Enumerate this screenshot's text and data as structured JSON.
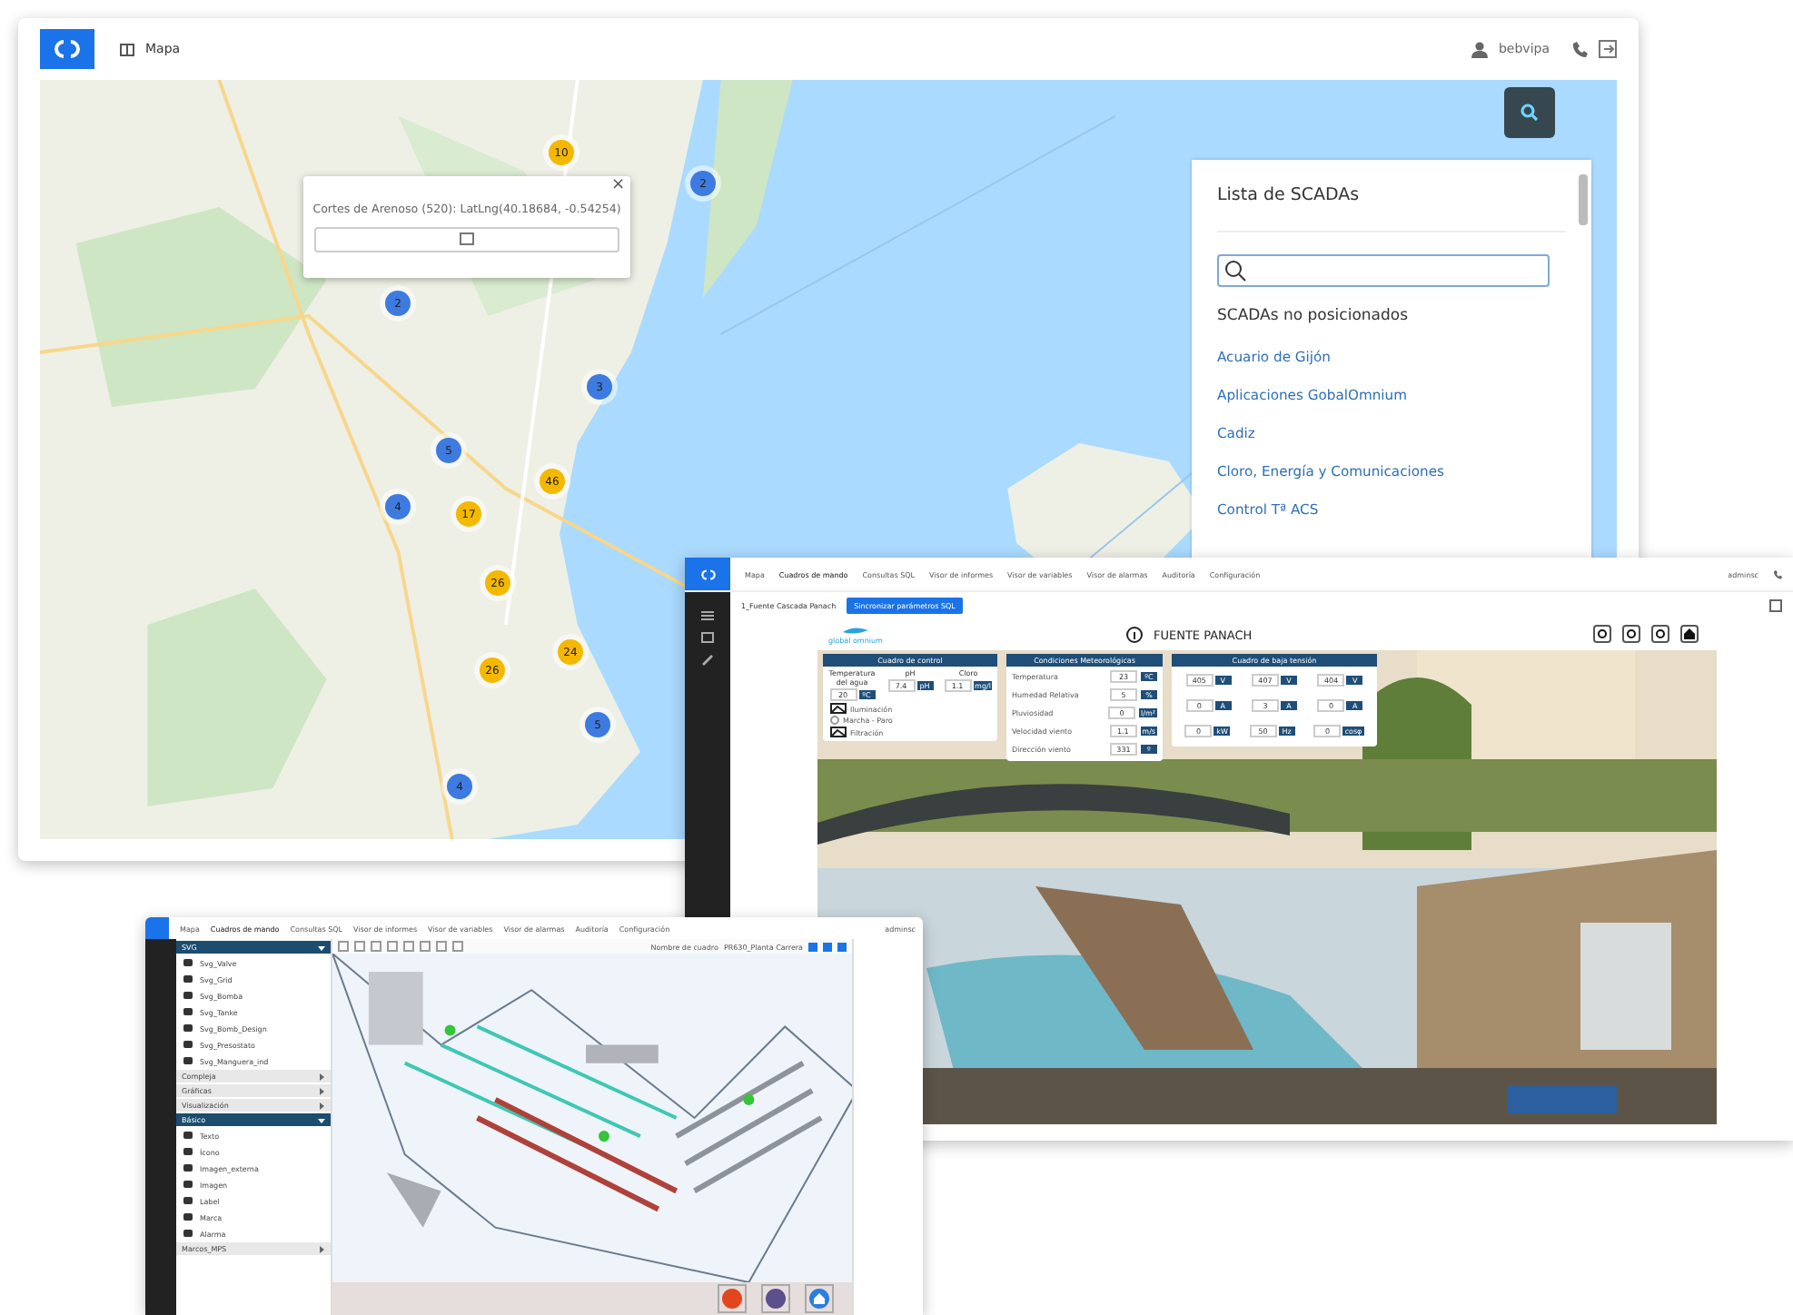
{
  "map_window": {
    "nav": [
      {
        "label": "Mapa",
        "selected": true
      }
    ],
    "user": "bebvipa",
    "popup": {
      "text": "Cortes de Arenoso (520): LatLng(40.18684, -0.54254)",
      "close": "×"
    },
    "markers": [
      {
        "count": "10",
        "color": "#f5b800"
      },
      {
        "count": "2",
        "color": "#3d7be0"
      },
      {
        "count": "2",
        "color": "#3d7be0"
      },
      {
        "count": "3",
        "color": "#3d7be0"
      },
      {
        "count": "5",
        "color": "#3d7be0"
      },
      {
        "count": "46",
        "color": "#f5b800"
      },
      {
        "count": "4",
        "color": "#3d7be0"
      },
      {
        "count": "17",
        "color": "#f5b800"
      },
      {
        "count": "26",
        "color": "#f5b800"
      },
      {
        "count": "26",
        "color": "#f5b800"
      },
      {
        "count": "24",
        "color": "#f5b800"
      },
      {
        "count": "5",
        "color": "#3d7be0"
      },
      {
        "count": "4",
        "color": "#3d7be0"
      }
    ],
    "scada_list": {
      "title": "Lista de SCADAs",
      "section": "SCADAs no posicionados",
      "items": [
        "Acuario de Gijón",
        "Aplicaciones GobalOmnium",
        "Cadiz",
        "Cloro, Energía y Comunicaciones",
        "Control Tª ACS"
      ]
    }
  },
  "scada_window": {
    "nav": [
      {
        "label": "Mapa",
        "selected": false
      },
      {
        "label": "Cuadros de mando",
        "selected": true
      },
      {
        "label": "Consultas SQL",
        "selected": false
      },
      {
        "label": "Visor de informes",
        "selected": false
      },
      {
        "label": "Visor de variables",
        "selected": false
      },
      {
        "label": "Visor de alarmas",
        "selected": false
      },
      {
        "label": "Auditoría",
        "selected": false
      },
      {
        "label": "Configuración",
        "selected": false
      }
    ],
    "user": "adminsc",
    "breadcrumb": "1_Fuente Cascada Panach",
    "action_button": "Sincronizar parámetros SQL",
    "brand": "global omnium",
    "title": "FUENTE PANACH",
    "control": {
      "title": "Cuadro de control",
      "measures": [
        {
          "label": "Temperatura del agua",
          "value": "20",
          "unit": "ºC"
        },
        {
          "label": "pH",
          "value": "7.4",
          "unit": "pH"
        },
        {
          "label": "Cloro",
          "value": "1.1",
          "unit": "mg/l"
        }
      ],
      "toggles": [
        {
          "label": "Iluminación",
          "kind": "switch"
        },
        {
          "label": "Marcha - Paro",
          "kind": "radio",
          "on": false
        },
        {
          "label": "Filtración",
          "kind": "switch"
        }
      ]
    },
    "weather": {
      "title": "Condiciones Meteorológicas",
      "rows": [
        {
          "label": "Temperatura",
          "value": "23",
          "unit": "ºC"
        },
        {
          "label": "Humedad Relativa",
          "value": "5",
          "unit": "%"
        },
        {
          "label": "Pluviosidad",
          "value": "0",
          "unit": "l/m²"
        },
        {
          "label": "Velocidad viento",
          "value": "1.1",
          "unit": "m/s"
        },
        {
          "label": "Dirección viento",
          "value": "331",
          "unit": "º"
        }
      ]
    },
    "low_voltage": {
      "title": "Cuadro de baja tensión",
      "rows": [
        [
          {
            "value": "405",
            "unit": "V"
          },
          {
            "value": "407",
            "unit": "V"
          },
          {
            "value": "404",
            "unit": "V"
          }
        ],
        [
          {
            "value": "0",
            "unit": "A"
          },
          {
            "value": "3",
            "unit": "A"
          },
          {
            "value": "0",
            "unit": "A"
          }
        ],
        [
          {
            "value": "0",
            "unit": "kW"
          },
          {
            "value": "50",
            "unit": "Hz"
          },
          {
            "value": "0",
            "unit": "cosφ"
          }
        ]
      ]
    }
  },
  "editor_window": {
    "nav": [
      {
        "label": "Mapa",
        "selected": false
      },
      {
        "label": "Cuadros de mando",
        "selected": true
      },
      {
        "label": "Consultas SQL",
        "selected": false
      },
      {
        "label": "Visor de informes",
        "selected": false
      },
      {
        "label": "Visor de variables",
        "selected": false
      },
      {
        "label": "Visor de alarmas",
        "selected": false
      },
      {
        "label": "Auditoría",
        "selected": false
      },
      {
        "label": "Configuración",
        "selected": false
      }
    ],
    "user": "adminsc",
    "palette": [
      {
        "label": "SVG",
        "kind": "header",
        "expanded": true
      },
      {
        "label": "Svg_Valve",
        "kind": "item"
      },
      {
        "label": "Svg_Grid",
        "kind": "item"
      },
      {
        "label": "Svg_Bomba",
        "kind": "item"
      },
      {
        "label": "Svg_Tanke",
        "kind": "item"
      },
      {
        "label": "Svg_Bomb_Design",
        "kind": "item"
      },
      {
        "label": "Svg_Presostato",
        "kind": "item"
      },
      {
        "label": "Svg_Manguera_ind",
        "kind": "item"
      },
      {
        "label": "Compleja",
        "kind": "header",
        "expanded": false
      },
      {
        "label": "Gráficas",
        "kind": "header",
        "expanded": false
      },
      {
        "label": "Visualización",
        "kind": "header",
        "expanded": false
      },
      {
        "label": "Básico",
        "kind": "header",
        "expanded": true
      },
      {
        "label": "Texto",
        "kind": "item"
      },
      {
        "label": "Ícono",
        "kind": "item"
      },
      {
        "label": "Imagen_externa",
        "kind": "item"
      },
      {
        "label": "Imagen",
        "kind": "item"
      },
      {
        "label": "Label",
        "kind": "item"
      },
      {
        "label": "Marca",
        "kind": "item"
      },
      {
        "label": "Alarma",
        "kind": "item"
      },
      {
        "label": "Marcos_MPS",
        "kind": "header",
        "expanded": false
      }
    ],
    "name_label": "Nombre de cuadro",
    "name_value": "PR630_Planta Carrera"
  }
}
